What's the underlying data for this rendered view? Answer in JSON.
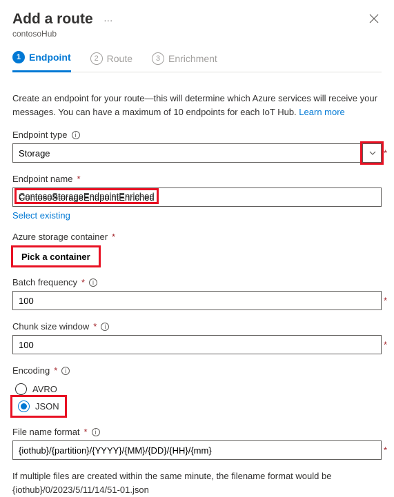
{
  "header": {
    "title": "Add a route",
    "subtitle": "contosoHub"
  },
  "tabs": [
    {
      "num": "1",
      "label": "Endpoint"
    },
    {
      "num": "2",
      "label": "Route"
    },
    {
      "num": "3",
      "label": "Enrichment"
    }
  ],
  "intro": {
    "text": "Create an endpoint for your route—this will determine which Azure services will receive your messages. You can have a maximum of 10 endpoints for each IoT Hub. ",
    "learn_more": "Learn more"
  },
  "fields": {
    "endpoint_type": {
      "label": "Endpoint type",
      "value": "Storage"
    },
    "endpoint_name": {
      "label": "Endpoint name",
      "value": "ContosoStorageEndpointEnriched",
      "select_existing": "Select existing"
    },
    "container": {
      "label": "Azure storage container",
      "button": "Pick a container"
    },
    "batch": {
      "label": "Batch frequency",
      "value": "100"
    },
    "chunk": {
      "label": "Chunk size window",
      "value": "100"
    },
    "encoding": {
      "label": "Encoding",
      "options": [
        "AVRO",
        "JSON"
      ]
    },
    "filename": {
      "label": "File name format",
      "value": "{iothub}/{partition}/{YYYY}/{MM}/{DD}/{HH}/{mm}"
    }
  },
  "footnote": "If multiple files are created within the same minute, the filename format would be {iothub}/0/2023/5/11/14/51-01.json"
}
